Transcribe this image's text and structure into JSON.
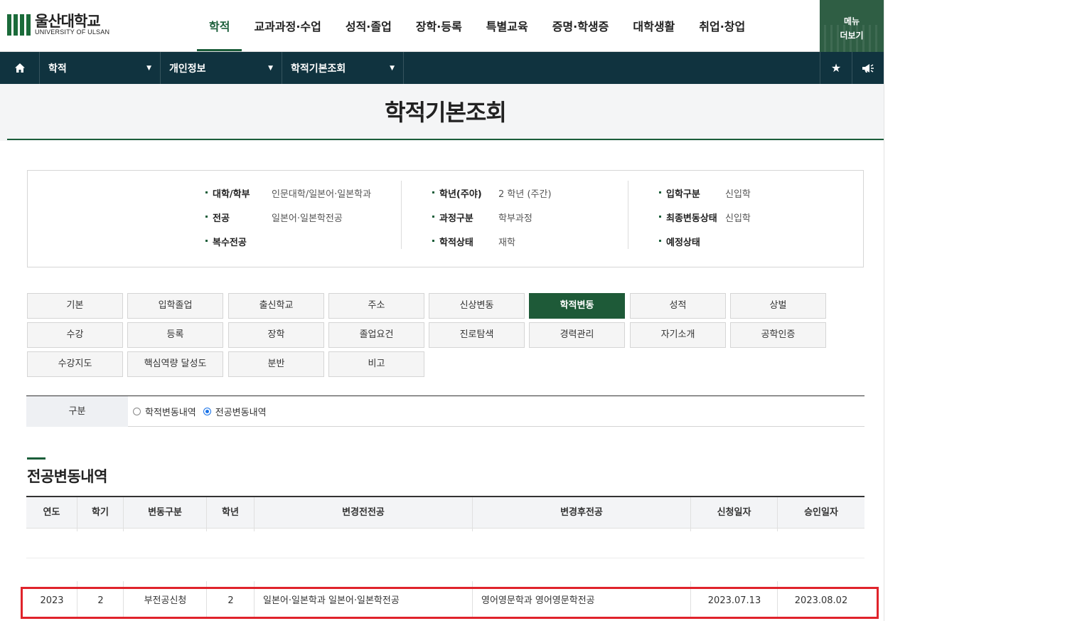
{
  "logo": {
    "name_ko": "울산대학교",
    "name_en": "UNIVERSITY OF ULSAN"
  },
  "gnb": [
    {
      "label": "학적",
      "active": true
    },
    {
      "label": "교과과정·수업"
    },
    {
      "label": "성적·졸업"
    },
    {
      "label": "장학·등록"
    },
    {
      "label": "특별교육"
    },
    {
      "label": "증명·학생증"
    },
    {
      "label": "대학생활"
    },
    {
      "label": "취업·창업"
    }
  ],
  "menu_more": {
    "line1": "메뉴",
    "line2": "더보기"
  },
  "location": {
    "level1": "학적",
    "level2": "개인정보",
    "level3": "학적기본조회"
  },
  "page_title": "학적기본조회",
  "info": {
    "col1": [
      {
        "key": "대학/학부",
        "value": "인문대학/일본어·일본학과"
      },
      {
        "key": "전공",
        "value": "일본어·일본학전공"
      },
      {
        "key": "복수전공",
        "value": ""
      }
    ],
    "col2": [
      {
        "key": "학년(주야)",
        "value": "2 학년 (주간)"
      },
      {
        "key": "과정구분",
        "value": "학부과정"
      },
      {
        "key": "학적상태",
        "value": "재학"
      }
    ],
    "col3": [
      {
        "key": "입학구분",
        "value": "신입학"
      },
      {
        "key": "최종변동상태",
        "value": "신입학"
      },
      {
        "key": "예정상태",
        "value": ""
      }
    ]
  },
  "tabs": [
    [
      "기본",
      "입학졸업",
      "출신학교",
      "주소",
      "신상변동",
      "학적변동",
      "성적",
      "상벌"
    ],
    [
      "수강",
      "등록",
      "장학",
      "졸업요건",
      "진로탐색",
      "경력관리",
      "자기소개",
      "공학인증"
    ],
    [
      "수강지도",
      "핵심역량 달성도",
      "분반",
      "비고"
    ]
  ],
  "active_tab": "학적변동",
  "search": {
    "label": "구분",
    "options": [
      {
        "label": "학적변동내역",
        "checked": false
      },
      {
        "label": "전공변동내역",
        "checked": true
      }
    ]
  },
  "section_title": "전공변동내역",
  "table": {
    "headers": [
      "연도",
      "학기",
      "변동구분",
      "학년",
      "변경전전공",
      "변경후전공",
      "신청일자",
      "승인일자"
    ],
    "rows": [
      [
        "2023",
        "2",
        "부전공신청",
        "2",
        "일본어·일본학과 일본어·일본학전공",
        "영어영문학과 영어영문학전공",
        "2023.07.13",
        "2023.08.02"
      ]
    ]
  },
  "colors": {
    "brand_green": "#1b5e3a",
    "locbar": "#10333f",
    "highlight_red": "#e0232b"
  }
}
